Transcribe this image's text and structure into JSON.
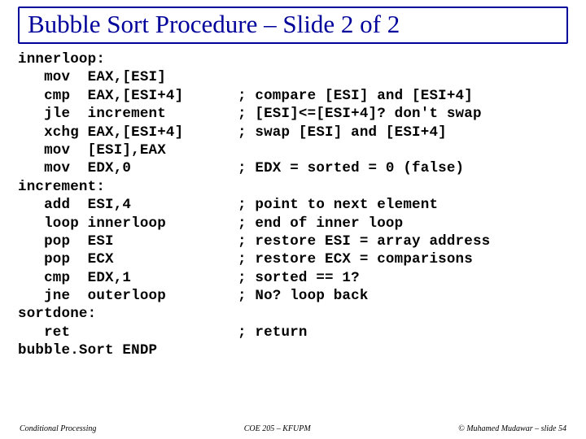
{
  "title": "Bubble Sort Procedure – Slide 2 of 2",
  "code": [
    {
      "l": "innerloop:",
      "r": ""
    },
    {
      "l": "   mov  EAX,[ESI]",
      "r": ""
    },
    {
      "l": "   cmp  EAX,[ESI+4]",
      "r": "; compare [ESI] and [ESI+4]"
    },
    {
      "l": "   jle  increment",
      "r": "; [ESI]<=[ESI+4]? don't swap"
    },
    {
      "l": "   xchg EAX,[ESI+4]",
      "r": "; swap [ESI] and [ESI+4]"
    },
    {
      "l": "   mov  [ESI],EAX",
      "r": ""
    },
    {
      "l": "   mov  EDX,0",
      "r": "; EDX = sorted = 0 (false)"
    },
    {
      "l": "increment:",
      "r": ""
    },
    {
      "l": "   add  ESI,4",
      "r": "; point to next element"
    },
    {
      "l": "   loop innerloop",
      "r": "; end of inner loop"
    },
    {
      "l": "   pop  ESI",
      "r": "; restore ESI = array address"
    },
    {
      "l": "   pop  ECX",
      "r": "; restore ECX = comparisons"
    },
    {
      "l": "   cmp  EDX,1",
      "r": "; sorted == 1?"
    },
    {
      "l": "   jne  outerloop",
      "r": "; No? loop back"
    },
    {
      "l": "sortdone:",
      "r": ""
    },
    {
      "l": "   ret",
      "r": "; return"
    },
    {
      "l": "bubble.Sort ENDP",
      "r": ""
    }
  ],
  "footer": {
    "left": "Conditional Processing",
    "center": "COE 205 – KFUPM",
    "right": "© Muhamed Mudawar – slide 54"
  }
}
